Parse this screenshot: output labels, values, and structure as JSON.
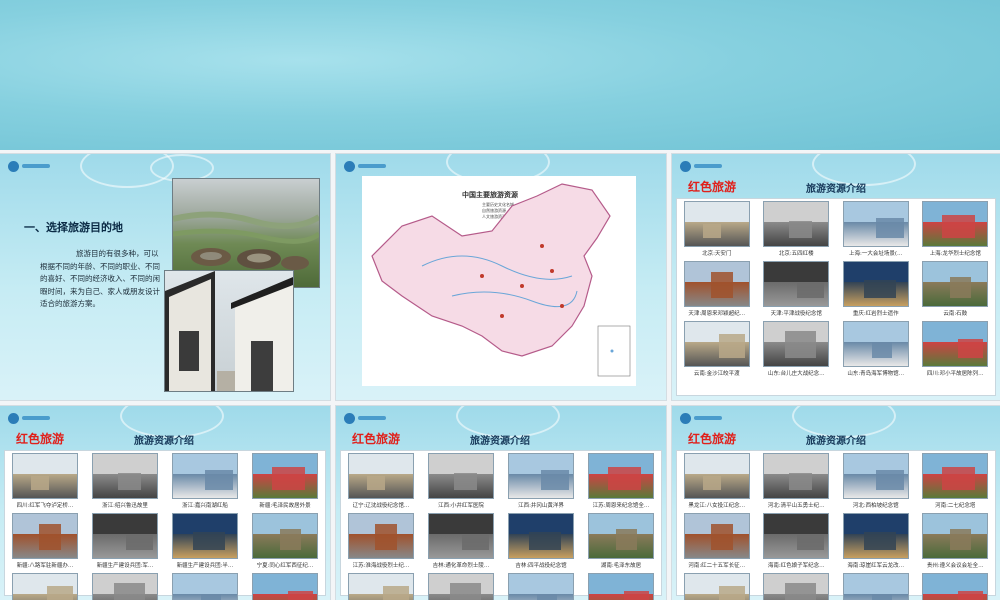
{
  "slide_red_title": "红色旅游",
  "slide_subtitle": "旅游资源介绍",
  "slide1": {
    "heading": "一、选择旅游目的地",
    "body": "旅游目的有很多种，可以根据不同的年龄、不同的职业、不同的喜好、不同的经济收入、不同的闲暇时间，来为自己、家人或朋友设计适合的旅游方案。"
  },
  "slide2": {
    "map_title": "中国主要旅游资源",
    "legend": [
      "主要历史文化名城",
      "自然旅游资源",
      "人文旅游资源"
    ]
  },
  "slide3": {
    "captions": [
      "北京:天安门",
      "北京:五四红楼",
      "上海:一大会址场景(…",
      "上海:龙华烈士纪念馆",
      "天津:周恩来邓颖超纪…",
      "天津:平津战役纪念馆",
      "重庆:红岩烈士遗作",
      "云南:石鼓",
      "云南:金沙江皎平渡",
      "山东:台儿庄大战纪念…",
      "山东:青岛海军博物馆…",
      "四川:邓小平故居陈列…"
    ]
  },
  "slide4": {
    "captions": [
      "四川:红军飞夺泸定桥…",
      "浙江:绍兴鲁迅故里",
      "浙江:嘉兴南湖红船",
      "新疆:毛泽民故居外景",
      "新疆:八路军驻新疆办…",
      "新疆生产建设兵团:军…",
      "新疆生产建设兵团:半…",
      "宁夏:同心红军西征纪…",
      "",
      "",
      "",
      ""
    ]
  },
  "slide5": {
    "captions": [
      "辽宁:辽沈战役纪念馆…",
      "江西:小井红军医院",
      "江西:井冈山黄洋界",
      "江苏:周恩来纪念馆全…",
      "江苏:淮海战役烈士纪…",
      "吉林:通化革命烈士陵…",
      "吉林:四平战役纪念馆",
      "湖南:毛泽东故居",
      "",
      "",
      "",
      ""
    ]
  },
  "slide6": {
    "captions": [
      "黑龙江:八女投江纪念…",
      "河北:清平山五勇士纪…",
      "河北:西柏坡纪念馆",
      "河南:二七纪念塔",
      "河南:红二十五军长征…",
      "海南:红色娘子军纪念…",
      "海南:琼崖红军云龙改…",
      "贵州:遵义会议会址全…",
      "",
      "",
      "",
      ""
    ]
  }
}
